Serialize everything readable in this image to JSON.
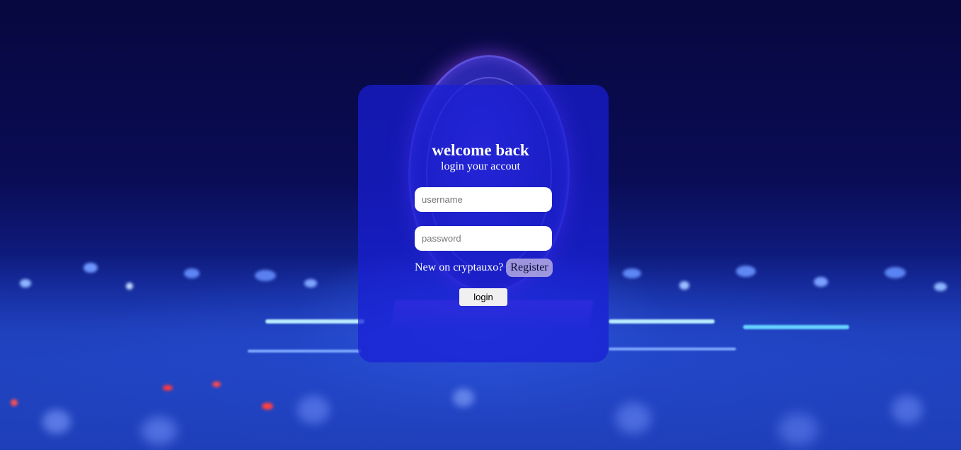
{
  "login": {
    "title": "welcome back",
    "subtitle": "login your accout",
    "username_placeholder": "username",
    "password_placeholder": "password",
    "register_prompt": "New on cryptauxo?",
    "register_label": "Register",
    "login_label": "login"
  },
  "theme": {
    "background": "#070a45",
    "card": "#191ed7",
    "accent": "#1f48c8"
  }
}
